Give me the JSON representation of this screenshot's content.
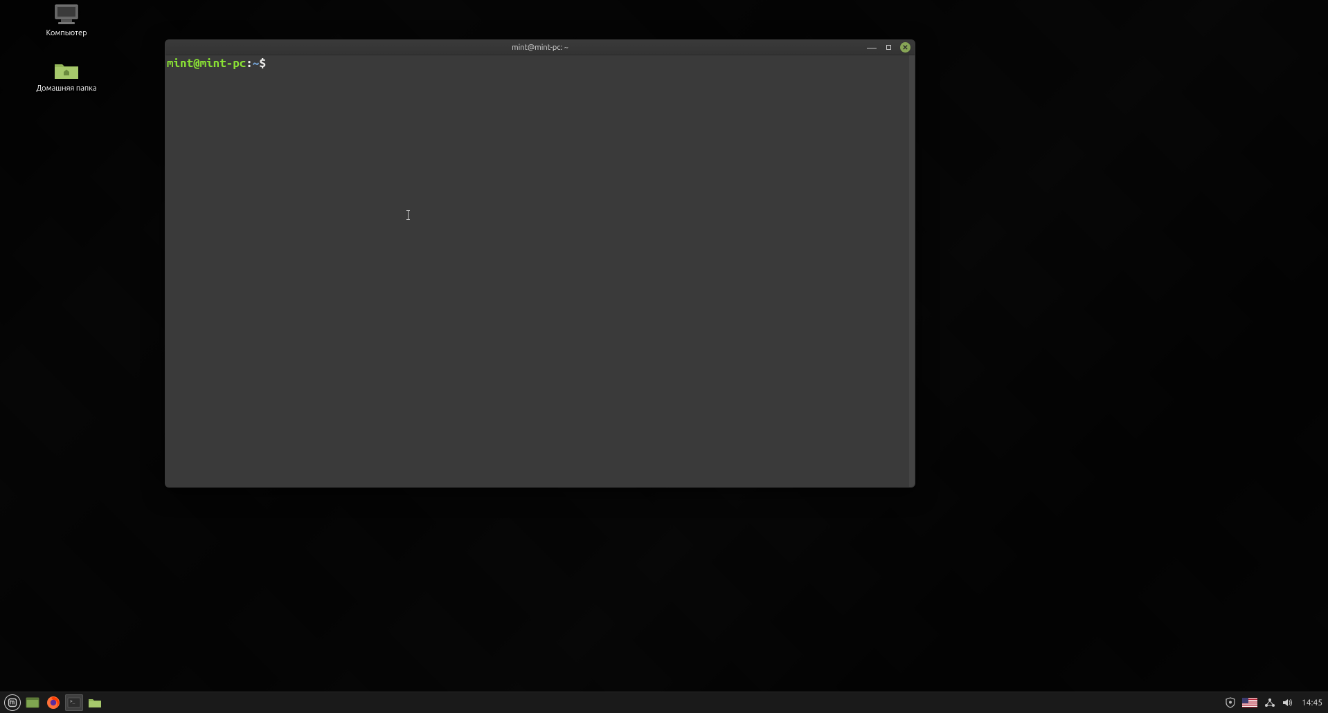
{
  "desktop": {
    "icons": [
      {
        "label": "Компьютер"
      },
      {
        "label": "Домашняя папка"
      }
    ]
  },
  "terminal": {
    "title": "mint@mint-pc: ~",
    "prompt": {
      "user_host": "mint@mint-pc",
      "colon": ":",
      "path": "~",
      "symbol": "$"
    }
  },
  "taskbar": {
    "clock": "14:45"
  }
}
